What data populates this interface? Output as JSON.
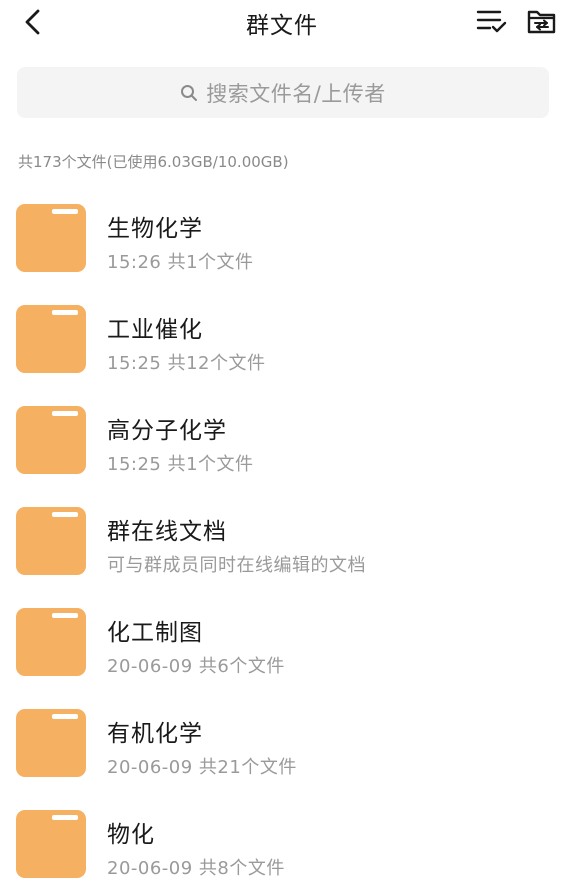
{
  "header": {
    "title": "群文件",
    "back_icon": "chevron-left-icon",
    "sort_icon": "sort-list-check-icon",
    "folder_icon": "folder-arrow-icon"
  },
  "search": {
    "placeholder": "搜索文件名/上传者",
    "icon": "search-icon"
  },
  "summary": "共173个文件(已使用6.03GB/10.00GB)",
  "colors": {
    "folder": "#f5b062",
    "folder_tab": "#ffffff",
    "text_primary": "#1a1a1a",
    "text_secondary": "#9a9a9a"
  },
  "folders": [
    {
      "name": "生物化学",
      "meta": "15:26  共1个文件"
    },
    {
      "name": "工业催化",
      "meta": "15:25  共12个文件"
    },
    {
      "name": "高分子化学",
      "meta": "15:25  共1个文件"
    },
    {
      "name": "群在线文档",
      "meta": "可与群成员同时在线编辑的文档"
    },
    {
      "name": "化工制图",
      "meta": "20-06-09  共6个文件"
    },
    {
      "name": "有机化学",
      "meta": "20-06-09  共21个文件"
    },
    {
      "name": "物化",
      "meta": "20-06-09  共8个文件"
    }
  ]
}
